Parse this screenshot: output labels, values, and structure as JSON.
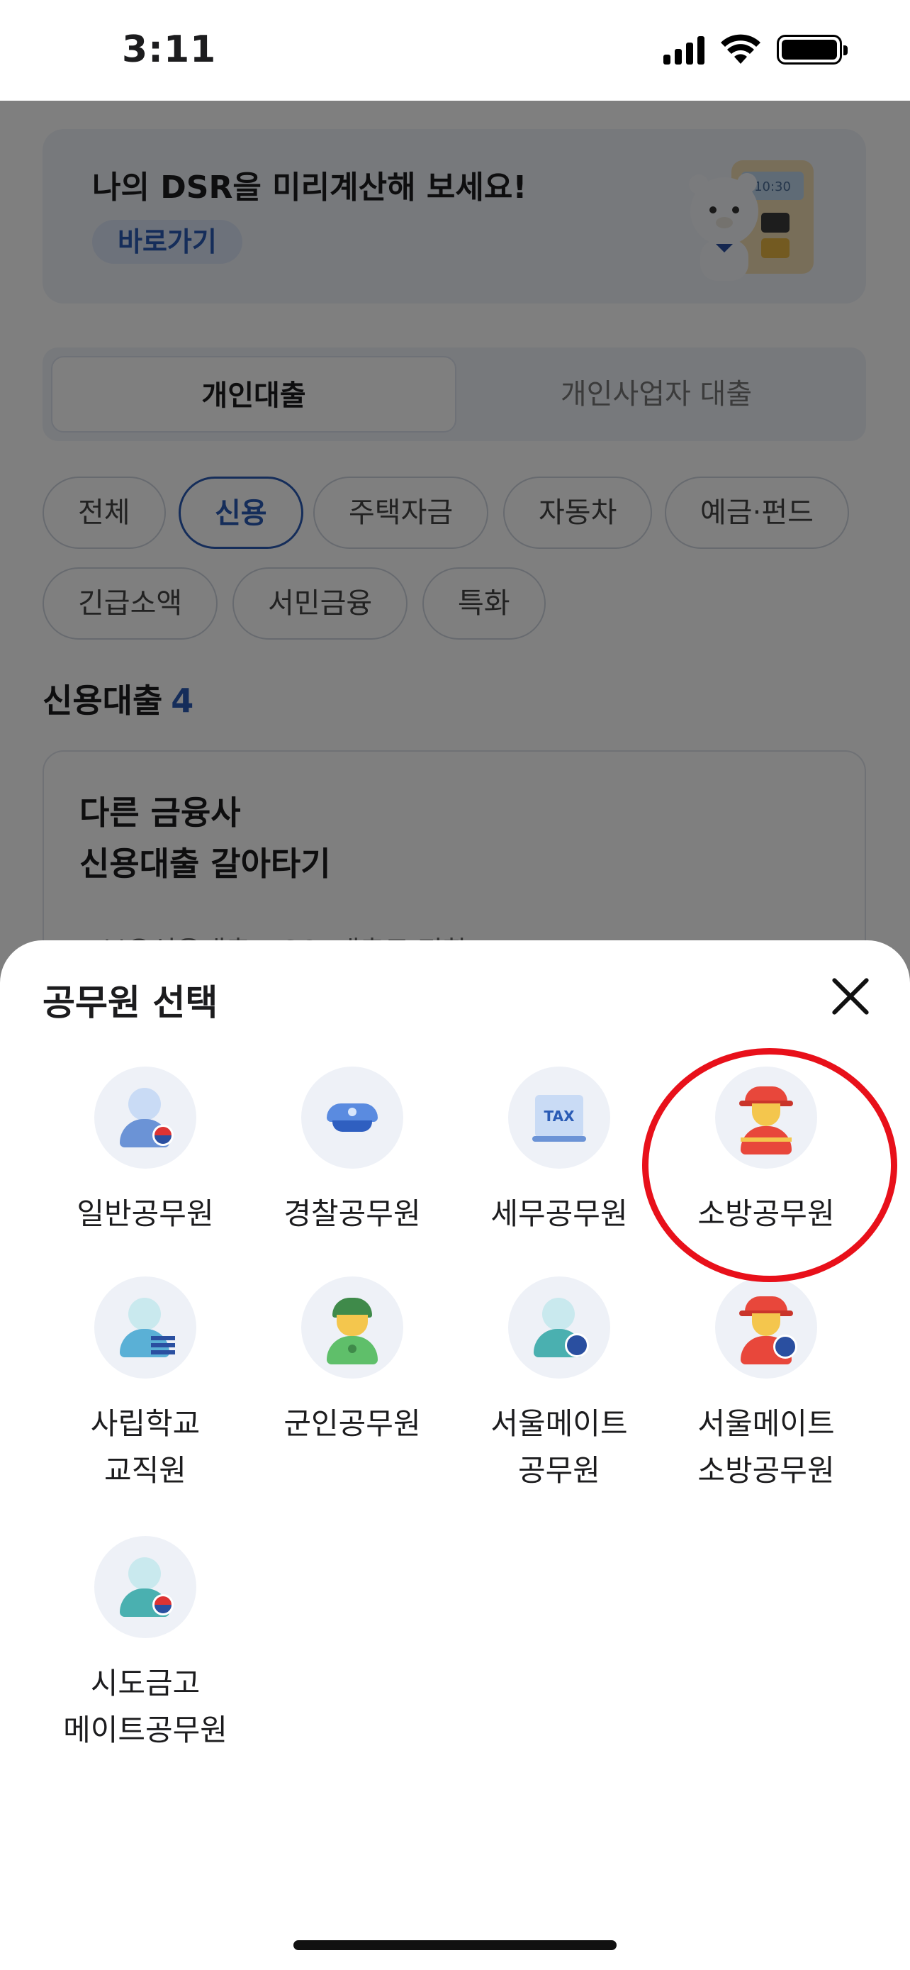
{
  "status_bar": {
    "time": "3:11"
  },
  "background": {
    "dsr_banner": {
      "title": "나의 DSR을 미리계산해 보세요!",
      "link": "바로가기",
      "device_display": "10:30"
    },
    "segment": {
      "active": "개인대출",
      "inactive": "개인사업자 대출"
    },
    "chips": [
      "전체",
      "신용",
      "주택자금",
      "자동차",
      "예금·펀드",
      "긴급소액",
      "서민금융",
      "특화"
    ],
    "active_chip": "신용",
    "section": {
      "title": "신용대출",
      "count": "4"
    },
    "card": {
      "title_line1": "다른 금융사",
      "title_line2": "신용대출 갈아타기",
      "tags": "#보유신용대출 #SOL대출로 전환"
    }
  },
  "sheet": {
    "title": "공무원 선택",
    "options": [
      {
        "line1": "일반공무원",
        "line2": "",
        "icon": "general-official-icon"
      },
      {
        "line1": "경찰공무원",
        "line2": "",
        "icon": "police-hat-icon"
      },
      {
        "line1": "세무공무원",
        "line2": "",
        "icon": "tax-icon",
        "icon_text": "TAX"
      },
      {
        "line1": "소방공무원",
        "line2": "",
        "icon": "firefighter-icon"
      },
      {
        "line1": "사립학교",
        "line2": "교직원",
        "icon": "teacher-icon"
      },
      {
        "line1": "군인공무원",
        "line2": "",
        "icon": "soldier-icon"
      },
      {
        "line1": "서울메이트",
        "line2": "공무원",
        "icon": "seoulmate-official-icon"
      },
      {
        "line1": "서울메이트",
        "line2": "소방공무원",
        "icon": "seoulmate-firefighter-icon"
      },
      {
        "line1": "시도금고",
        "line2": "메이트공무원",
        "icon": "city-treasury-official-icon"
      }
    ],
    "highlighted": "소방공무원"
  },
  "colors": {
    "accent": "#2a5bb5",
    "highlight_ring": "#e8101a",
    "icon_bg": "#eef1f7"
  }
}
